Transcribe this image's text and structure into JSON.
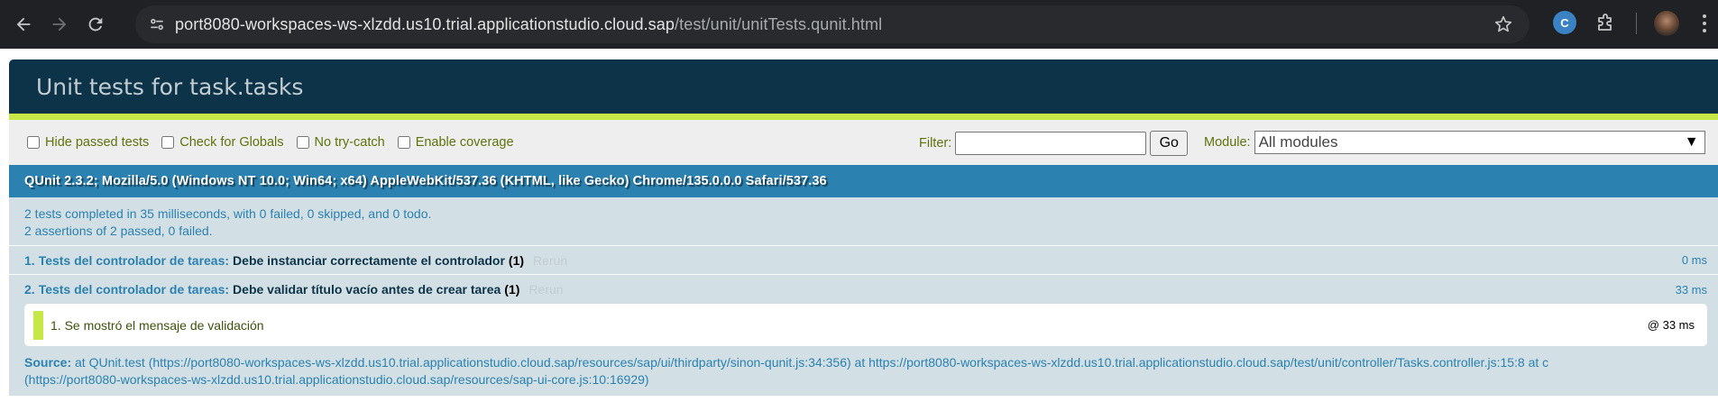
{
  "browser": {
    "url_host": "port8080-workspaces-ws-xlzdd.us10.trial.applicationstudio.cloud.sap",
    "url_path": "/test/unit/unitTests.qunit.html",
    "extension_badge": "C"
  },
  "page": {
    "title": "Unit tests for task.tasks"
  },
  "toolbar": {
    "hide_passed": "Hide passed tests",
    "check_globals": "Check for Globals",
    "no_try_catch": "No try-catch",
    "enable_coverage": "Enable coverage",
    "filter_label": "Filter:",
    "filter_value": "",
    "go_label": "Go",
    "module_label": "Module:",
    "module_selected": "All modules"
  },
  "user_agent": "QUnit 2.3.2; Mozilla/5.0 (Windows NT 10.0; Win64; x64) AppleWebKit/537.36 (KHTML, like Gecko) Chrome/135.0.0.0 Safari/537.36",
  "summary": {
    "line1": "2 tests completed in 35 milliseconds, with 0 failed, 0 skipped, and 0 todo.",
    "line2": "2 assertions of 2 passed, 0 failed."
  },
  "tests": [
    {
      "number": "1.",
      "module": "Tests del controlador de tareas:",
      "name": "Debe instanciar correctamente el controlador",
      "count": "(1)",
      "rerun": "Rerun",
      "duration": "0 ms"
    },
    {
      "number": "2.",
      "module": "Tests del controlador de tareas:",
      "name": "Debe validar título vacío antes de crear tarea",
      "count": "(1)",
      "rerun": "Rerun",
      "duration": "33 ms",
      "assertion": {
        "text": "1. Se mostró el mensaje de validación",
        "duration": "@ 33 ms"
      },
      "source_label": "Source:",
      "source_text": " at QUnit.test (https://port8080-workspaces-ws-xlzdd.us10.trial.applicationstudio.cloud.sap/resources/sap/ui/thirdparty/sinon-qunit.js:34:356) at https://port8080-workspaces-ws-xlzdd.us10.trial.applicationstudio.cloud.sap/test/unit/controller/Tasks.controller.js:15:8 at c",
      "source_text2": "(https://port8080-workspaces-ws-xlzdd.us10.trial.applicationstudio.cloud.sap/resources/sap-ui-core.js:10:16929)"
    }
  ]
}
